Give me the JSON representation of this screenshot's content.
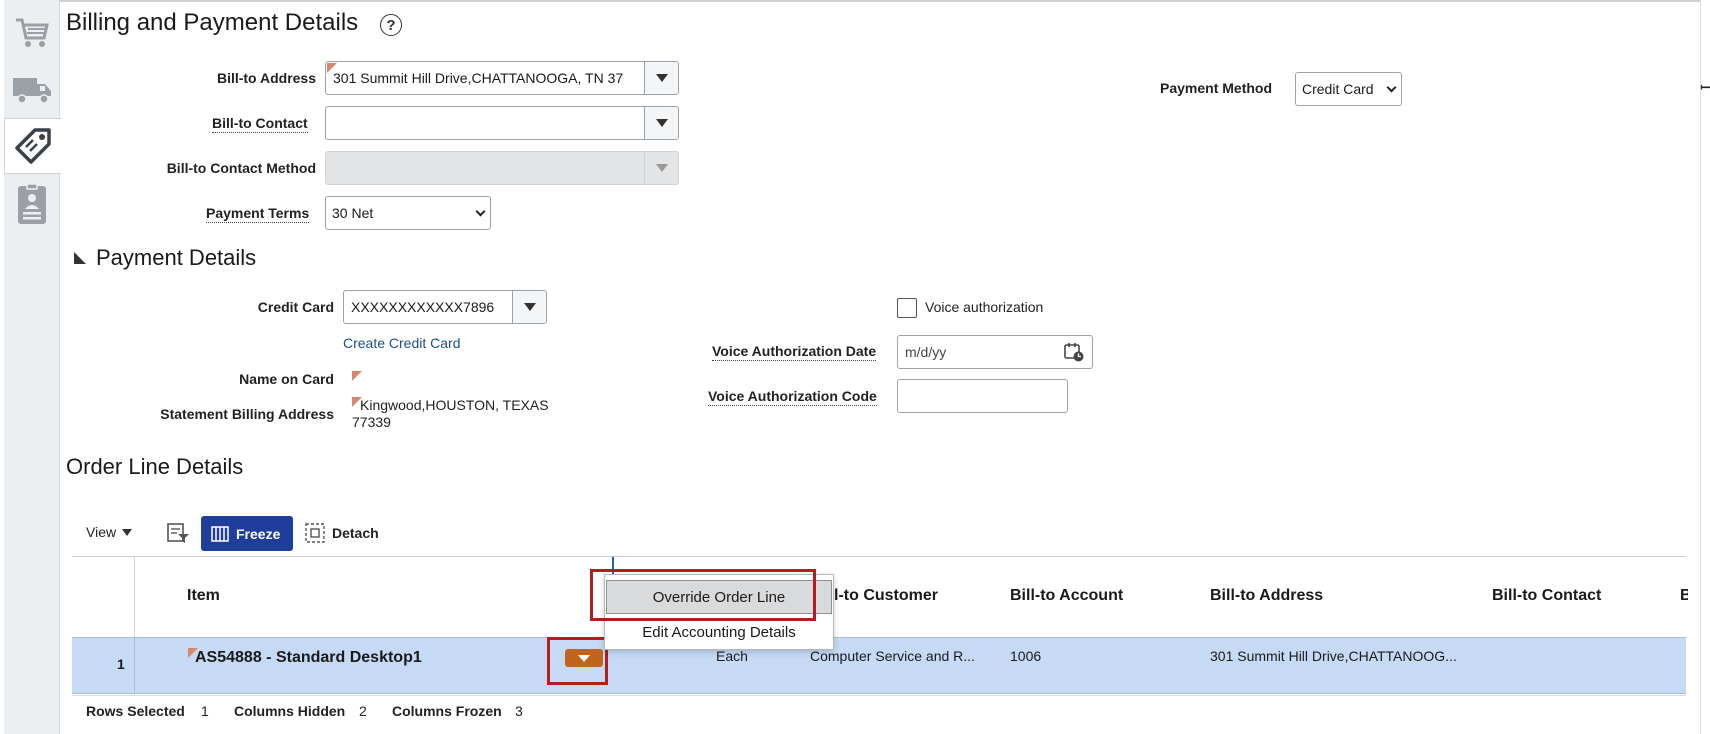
{
  "section_title": "Billing and Payment Details",
  "help_icon": "question-circle-icon",
  "rail_icons": [
    "shopping-cart-icon",
    "delivery-truck-icon",
    "price-tag-icon",
    "contact-card-icon"
  ],
  "billing": {
    "bill_to_address_label": "Bill-to Address",
    "bill_to_address_value": "301 Summit Hill Drive,CHATTANOOGA, TN 37",
    "bill_to_contact_label": "Bill-to Contact",
    "bill_to_contact_value": "",
    "bill_to_contact_method_label": "Bill-to Contact Method",
    "bill_to_contact_method_value": "",
    "payment_terms_label": "Payment Terms",
    "payment_terms_value": "30 Net",
    "payment_method_label": "Payment Method",
    "payment_method_value": "Credit Card"
  },
  "payment_details": {
    "title": "Payment Details",
    "credit_card_label": "Credit Card",
    "credit_card_value": "XXXXXXXXXXXX7896",
    "create_credit_card_link": "Create Credit Card",
    "name_on_card_label": "Name on Card",
    "statement_billing_address_label": "Statement Billing Address",
    "statement_billing_address_line1": "Kingwood,HOUSTON, TEXAS",
    "statement_billing_address_line2": "77339",
    "voice_authorization_label": "Voice authorization",
    "voice_authorization_checked": false,
    "voice_authorization_date_label": "Voice Authorization Date",
    "voice_authorization_date_placeholder": "m/d/yy",
    "voice_authorization_code_label": "Voice Authorization Code",
    "voice_authorization_code_value": ""
  },
  "order_lines": {
    "title": "Order Line Details",
    "toolbar": {
      "view_label": "View",
      "freeze_label": "Freeze",
      "detach_label": "Detach"
    },
    "columns": [
      "Item",
      "Bill-to Customer",
      "Bill-to Account",
      "Bill-to Address",
      "Bill-to Contact",
      "B"
    ],
    "rows": [
      {
        "row_number": "1",
        "item": "AS54888 - Standard Desktop1",
        "uom_partial": "Each",
        "bill_to_customer": "Computer Service and R...",
        "bill_to_account": "1006",
        "bill_to_address": "301 Summit Hill Drive,CHATTANOOG...",
        "bill_to_contact": ""
      }
    ],
    "context_menu": [
      "Override Order Line",
      "Edit Accounting Details"
    ],
    "footer": {
      "rows_selected_label": "Rows Selected",
      "rows_selected_value": "1",
      "columns_hidden_label": "Columns Hidden",
      "columns_hidden_value": "2",
      "columns_frozen_label": "Columns Frozen",
      "columns_frozen_value": "3"
    }
  },
  "colors": {
    "accent_blue": "#1f3e9b",
    "selected_row": "#c6daf6",
    "highlight_red": "#b21e1e",
    "action_orange": "#c0651d",
    "link_blue": "#1e4f8a"
  }
}
